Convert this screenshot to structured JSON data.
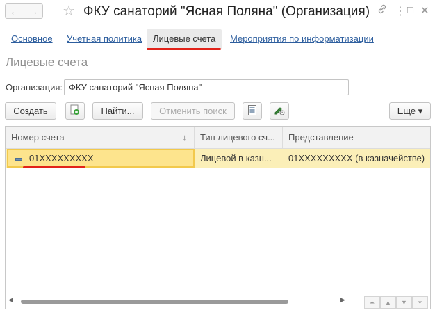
{
  "window": {
    "title": "ФКУ санаторий \"Ясная Поляна\" (Организация)",
    "back_icon": "←",
    "forward_icon": "→",
    "star_icon": "☆",
    "link_icon": "🔗",
    "menu_icon": "⋮",
    "maximize_icon": "□",
    "close_icon": "✕"
  },
  "tabs": [
    {
      "label": "Основное"
    },
    {
      "label": "Учетная политика"
    },
    {
      "label": "Лицевые счета"
    },
    {
      "label": "Мероприятия по информатизации"
    }
  ],
  "section_title": "Лицевые счета",
  "organization": {
    "label": "Организация:",
    "value": "ФКУ санаторий \"Ясная Поляна\""
  },
  "toolbar": {
    "create_label": "Создать",
    "find_label": "Найти...",
    "cancel_search_label": "Отменить поиск",
    "more_label": "Еще ▾"
  },
  "table": {
    "columns": [
      "Номер счета",
      "Тип лицевого сч...",
      "Представление"
    ],
    "sort_indicator": "↓",
    "rows": [
      {
        "number": "01XXXXXXXXX",
        "type": "Лицевой в казн...",
        "presentation": "01XXXXXXXXX (в казначействе)"
      }
    ]
  },
  "colors": {
    "accent_red": "#e2231a",
    "link_blue": "#2d5e9e",
    "row_highlight": "#fbefb8"
  }
}
